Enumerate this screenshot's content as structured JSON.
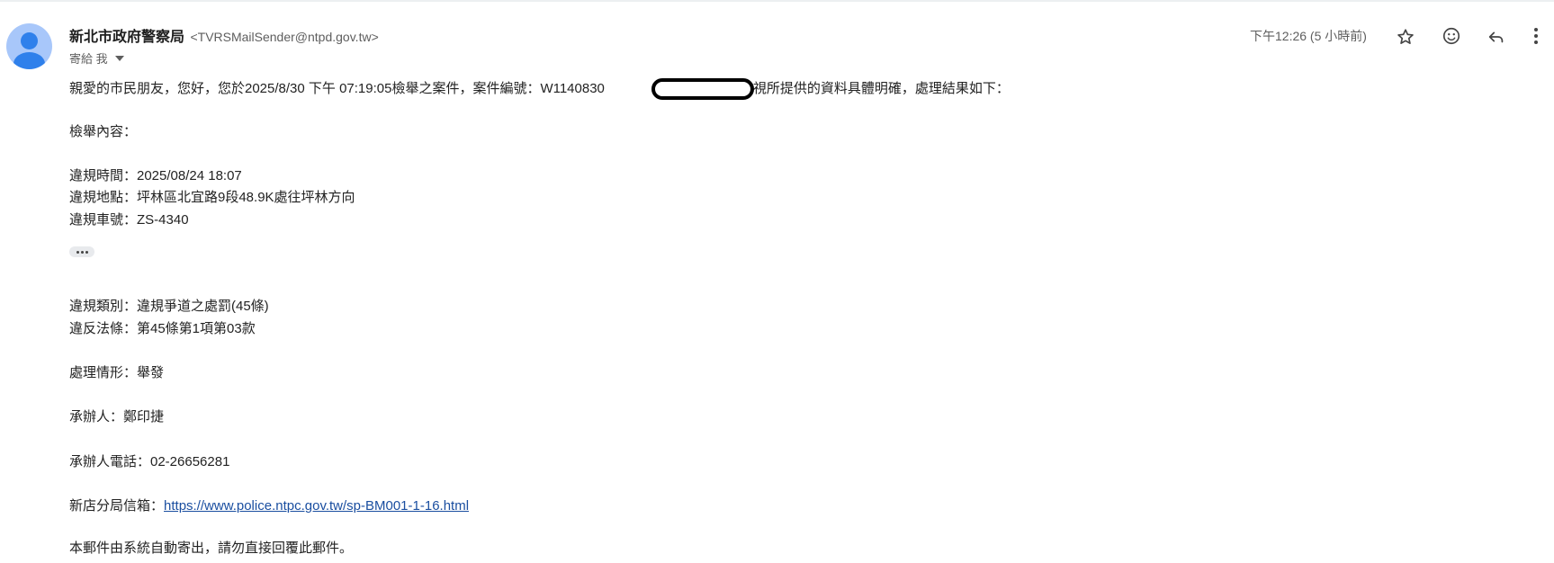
{
  "sender": {
    "name": "新北市政府警察局",
    "email": "<TVRSMailSender@ntpd.gov.tw>"
  },
  "recipient": {
    "label": "寄給 我"
  },
  "timestamp": "下午12:26 (5 小時前)",
  "icons": {
    "star": "star-icon",
    "emoji": "emoji-icon",
    "reply": "reply-icon",
    "more": "more-vert-icon"
  },
  "body": {
    "intro_before": "親愛的市民朋友，您好，您於2025/8/30 下午 07:19:05檢舉之案件，案件編號：W1140830",
    "intro_after": "，經檢視所提供的資料具體明確，處理結果如下：",
    "report_heading": "檢舉內容：",
    "violation_time": "違規時間：2025/08/24 18:07",
    "violation_location": "違規地點：坪林區北宜路9段48.9K處往坪林方向",
    "violation_plate": "違規車號：ZS-4340",
    "violation_category": "違規類別：違規爭道之處罰(45條)",
    "violation_law": "違反法條：第45條第1項第03款",
    "handling_status": "處理情形：舉發",
    "officer": "承辦人：鄭印捷",
    "officer_phone": "承辦人電話：02-26656281",
    "mailbox_label": "新店分局信箱：",
    "mailbox_url": "https://www.police.ntpc.gov.tw/sp-BM001-1-16.html",
    "footer_note": "本郵件由系統自動寄出，請勿直接回覆此郵件。"
  }
}
